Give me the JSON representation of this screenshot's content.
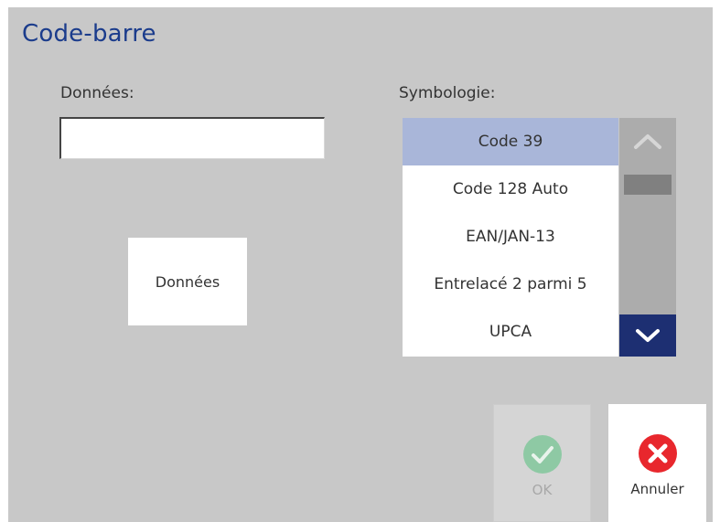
{
  "dialog": {
    "title": "Code-barre"
  },
  "data_section": {
    "label": "Données:",
    "input_value": "",
    "button_label": "Données"
  },
  "symbology": {
    "label": "Symbologie:",
    "selected": "Code 39",
    "items": [
      "Code 39",
      "Code 128 Auto",
      "EAN/JAN-13",
      "Entrelacé 2 parmi 5",
      "UPCA"
    ]
  },
  "scrollbar": {
    "up_icon": "chevron-up-icon",
    "down_icon": "chevron-down-icon"
  },
  "footer": {
    "ok_label": "OK",
    "cancel_label": "Annuler",
    "ok_color": "#8ec9a4",
    "cancel_color": "#e8272d"
  }
}
